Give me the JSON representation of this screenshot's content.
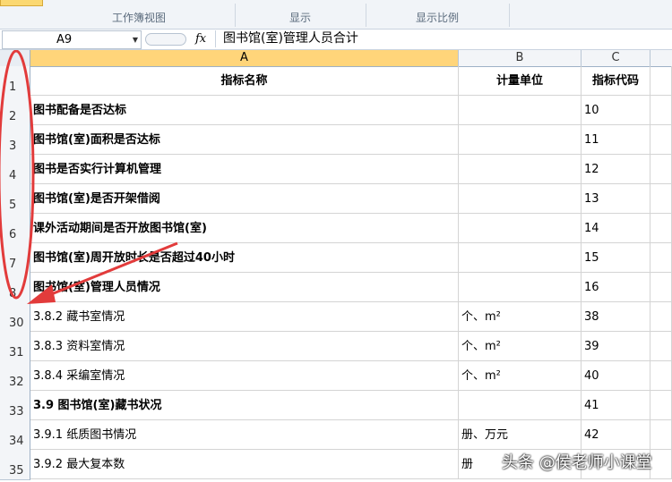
{
  "ribbon": {
    "groups": [
      "工作簿视图",
      "显示",
      "显示比例"
    ]
  },
  "formula_bar": {
    "name_box": "A9",
    "fx_label": "fx",
    "content": "图书馆(室)管理人员合计"
  },
  "columns": [
    "A",
    "B",
    "C"
  ],
  "rows": [
    {
      "num": "1",
      "a": "指标名称",
      "b": "计量单位",
      "c": "指标代码",
      "bold": true,
      "header": true
    },
    {
      "num": "2",
      "a": "图书配备是否达标",
      "b": "",
      "c": "10",
      "bold": true
    },
    {
      "num": "3",
      "a": "图书馆(室)面积是否达标",
      "b": "",
      "c": "11",
      "bold": true
    },
    {
      "num": "4",
      "a": "图书是否实行计算机管理",
      "b": "",
      "c": "12",
      "bold": true
    },
    {
      "num": "5",
      "a": "图书馆(室)是否开架借阅",
      "b": "",
      "c": "13",
      "bold": true
    },
    {
      "num": "6",
      "a": "课外活动期间是否开放图书馆(室)",
      "b": "",
      "c": "14",
      "bold": true
    },
    {
      "num": "7",
      "a": "图书馆(室)周开放时长是否超过40小时",
      "b": "",
      "c": "15",
      "bold": true
    },
    {
      "num": "8",
      "a": "图书馆(室)管理人员情况",
      "b": "",
      "c": "16",
      "bold": true
    },
    {
      "num": "30",
      "a": "3.8.2 藏书室情况",
      "b": "个、m²",
      "c": "38",
      "bold": false
    },
    {
      "num": "31",
      "a": "3.8.3 资料室情况",
      "b": "个、m²",
      "c": "39",
      "bold": false
    },
    {
      "num": "32",
      "a": "3.8.4 采编室情况",
      "b": "个、m²",
      "c": "40",
      "bold": false
    },
    {
      "num": "33",
      "a": "3.9 图书馆(室)藏书状况",
      "b": "",
      "c": "41",
      "bold": true
    },
    {
      "num": "34",
      "a": "3.9.1 纸质图书情况",
      "b": "册、万元",
      "c": "42",
      "bold": false
    },
    {
      "num": "35",
      "a": "3.9.2 最大复本数",
      "b": "册",
      "c": "",
      "bold": false
    }
  ],
  "watermark": "头条 @侯老师小课堂",
  "colors": {
    "annotation": "#e23b3b",
    "selected_column": "#ffd57a"
  }
}
